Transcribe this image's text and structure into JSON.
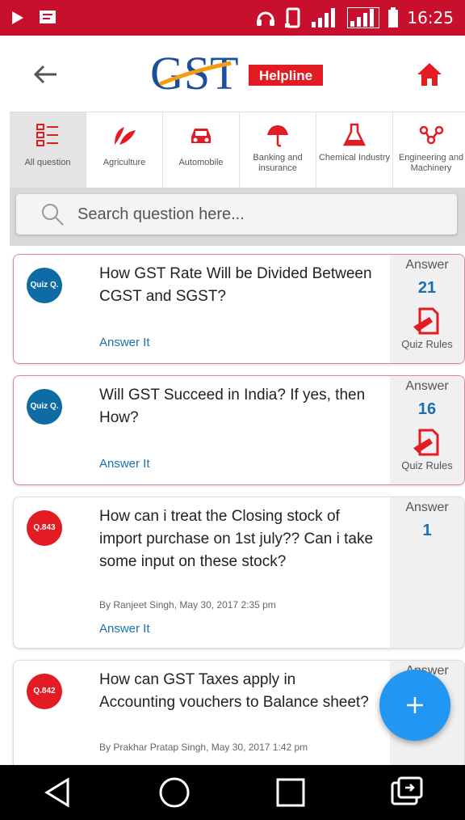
{
  "status_bar": {
    "time": "16:25"
  },
  "app": {
    "logo_main": "GST",
    "logo_badge": "Helpline"
  },
  "categories": [
    {
      "label": "All question",
      "icon": "list-icon",
      "active": true
    },
    {
      "label": "Agriculture",
      "icon": "leaf-icon"
    },
    {
      "label": "Automobile",
      "icon": "car-icon"
    },
    {
      "label": "Banking and insurance",
      "icon": "umbrella-icon"
    },
    {
      "label": "Chemical Industry",
      "icon": "flask-icon"
    },
    {
      "label": "Engineering and Machinery",
      "icon": "nodes-icon"
    }
  ],
  "search": {
    "placeholder": "Search question here..."
  },
  "questions": [
    {
      "badge": "Quiz Q.",
      "text": "How GST Rate Will be Divided Between CGST and SGST?",
      "byline": "",
      "answer_label": "Answer",
      "answer_count": "21",
      "action": "Answer It",
      "quiz_rules": "Quiz Rules"
    },
    {
      "badge": "Quiz Q.",
      "text": "Will GST Succeed in India? If yes, then How?",
      "byline": "",
      "answer_label": "Answer",
      "answer_count": "16",
      "action": "Answer It",
      "quiz_rules": "Quiz Rules"
    },
    {
      "badge": "Q.843",
      "text": "How can i treat the Closing stock of import purchase on 1st july?? Can i take some input on these stock?",
      "byline": "By Ranjeet Singh, May 30, 2017 2:35 pm",
      "answer_label": "Answer",
      "answer_count": "1",
      "action": "Answer It"
    },
    {
      "badge": "Q.842",
      "text": "How can GST Taxes apply in Accounting vouchers to Balance sheet?",
      "byline": "By Prakhar Pratap Singh, May 30, 2017 1:42 pm",
      "answer_label": "Answer"
    }
  ],
  "colors": {
    "status_bar": "#c8102e",
    "accent_blue": "#1a6fb0",
    "fab": "#2196f3",
    "quiz_badge": "#0f6ba3",
    "question_badge": "#e31b23"
  }
}
